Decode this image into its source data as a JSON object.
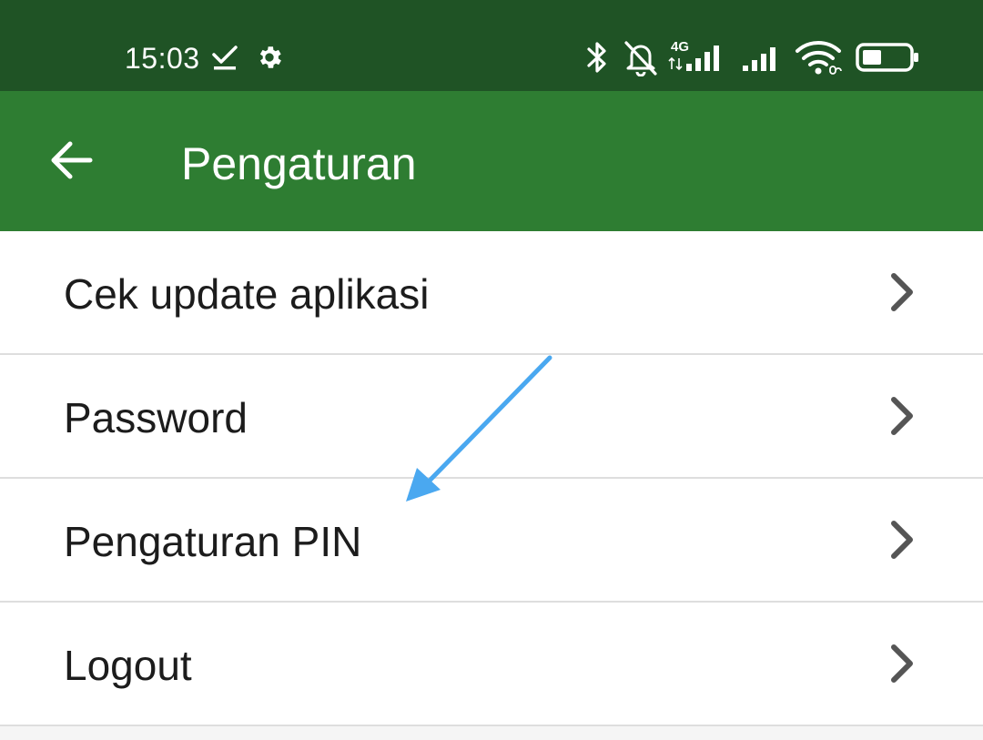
{
  "status_bar": {
    "time": "15:03",
    "network_type": "4G",
    "icons": [
      "download-done-icon",
      "settings-gear-icon",
      "bluetooth-icon",
      "notifications-off-icon",
      "signal-4g-icon",
      "signal-icon",
      "wifi-icon",
      "battery-icon"
    ],
    "background_color": "#1f5325"
  },
  "app_bar": {
    "title": "Pengaturan",
    "back_icon": "arrow-back-icon",
    "background_color": "#2e7d32"
  },
  "menu": {
    "items": [
      {
        "label": "Cek update aplikasi"
      },
      {
        "label": "Password"
      },
      {
        "label": "Pengaturan PIN"
      },
      {
        "label": "Logout"
      }
    ],
    "chevron_icon": "chevron-right-icon"
  },
  "annotation": {
    "type": "pointer-arrow",
    "color": "#4aa8f0",
    "points_to": "Pengaturan PIN"
  }
}
